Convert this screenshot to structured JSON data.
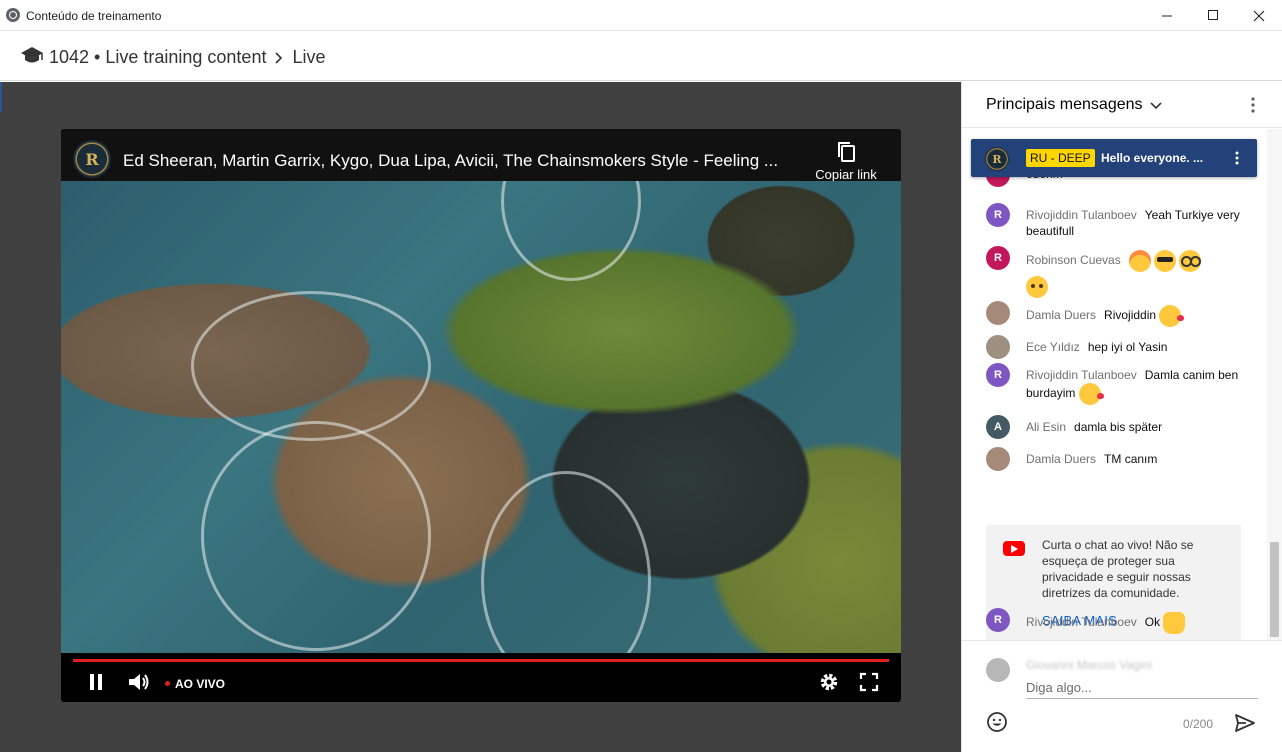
{
  "window": {
    "title": "Conteúdo de treinamento",
    "controls": [
      "minimize-icon",
      "maximize-icon",
      "close-icon"
    ]
  },
  "breadcrumb": {
    "course": "1042 • Live training content",
    "current": "Live"
  },
  "player": {
    "title": "Ed Sheeran, Martin Garrix, Kygo, Dua Lipa, Avicii, The Chainsmokers Style - Feeling ...",
    "channel_logo_letter": "R",
    "copy_link_label": "Copiar link",
    "live_label": "AO VIVO",
    "progress": 1.0,
    "colors": {
      "progress": "#e0201c",
      "live_dot": "#e0201c"
    }
  },
  "chat": {
    "header_title": "Principais mensagens",
    "pinned": {
      "logo_letter": "R",
      "badge": "RU - DEEP",
      "message": "Hello everyone. ...",
      "badge_color": "#ffd600",
      "bg_color": "#23427a"
    },
    "messages": [
      {
        "author": "",
        "text": "ederim",
        "avatar_letter": "",
        "avatar_color": "#c2185b"
      },
      {
        "author": "Rivojiddin Tulanboev",
        "text": "Yeah Turkiye very beautifull",
        "avatar_letter": "R",
        "avatar_color": "#7e57c2"
      },
      {
        "author": "Robinson Cuevas",
        "text": "",
        "avatar_letter": "R",
        "avatar_color": "#c2185b"
      },
      {
        "author": "Damla Duers",
        "text": "Rivojiddin",
        "avatar_letter": "",
        "avatar_color": "#a58a7a"
      },
      {
        "author": "Ece Yıldız",
        "text": "hep iyi ol Yasin",
        "avatar_letter": "",
        "avatar_color": "#9e8f80"
      },
      {
        "author": "Rivojiddin Tulanboev",
        "text": "Damla canim ben burdayim",
        "avatar_letter": "R",
        "avatar_color": "#7e57c2"
      },
      {
        "author": "Ali Esin",
        "text": "damla bis später",
        "avatar_letter": "A",
        "avatar_color": "#455a64"
      },
      {
        "author": "Damla Duers",
        "text": "TM canım",
        "avatar_letter": "",
        "avatar_color": "#a58a7a"
      },
      {
        "author": "Rivojiddin Tulanboev",
        "text": "Ok",
        "avatar_letter": "R",
        "avatar_color": "#7e57c2"
      }
    ],
    "notice": {
      "text": "Curta o chat ao vivo! Não se esqueça de proteger sua privacidade e seguir nossas diretrizes da comunidade.",
      "link": "SAIBA MAIS",
      "link_color": "#065fd4"
    },
    "compose": {
      "user_name": "Giovanni Marcos Vagini",
      "placeholder": "Diga algo...",
      "counter": "0/200"
    }
  }
}
